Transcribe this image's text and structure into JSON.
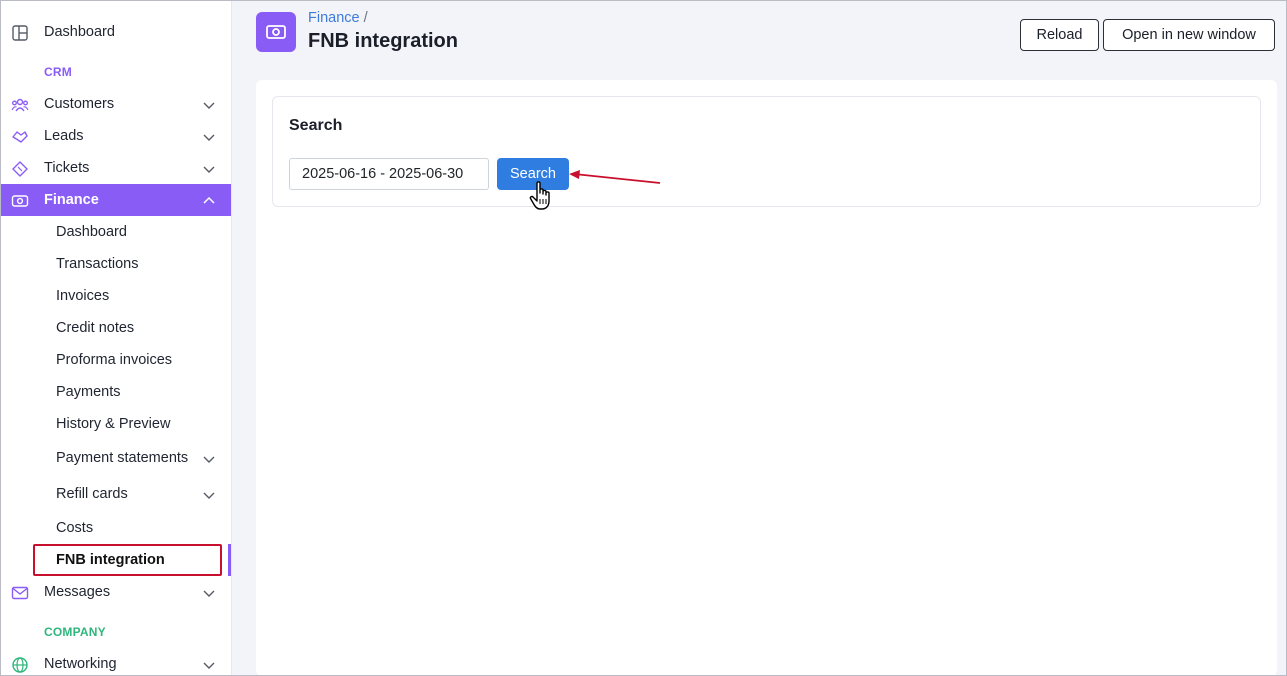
{
  "sidebar": {
    "dashboard": "Dashboard",
    "crm_section": "CRM",
    "crm_items": [
      {
        "label": "Customers",
        "icon": "customers-icon"
      },
      {
        "label": "Leads",
        "icon": "leads-icon"
      },
      {
        "label": "Tickets",
        "icon": "tickets-icon"
      }
    ],
    "finance": {
      "label": "Finance",
      "icon": "finance-icon"
    },
    "finance_sub": [
      "Dashboard",
      "Transactions",
      "Invoices",
      "Credit notes",
      "Proforma invoices",
      "Payments",
      "History & Preview",
      "Payment statements",
      "Refill cards",
      "Costs",
      "FNB integration"
    ],
    "messages": "Messages",
    "company_section": "COMPANY",
    "networking": "Networking"
  },
  "header": {
    "breadcrumb": "Finance",
    "breadcrumb_sep": "/",
    "title": "FNB integration",
    "reload_label": "Reload",
    "open_window_label": "Open in new window"
  },
  "search": {
    "title": "Search",
    "date_range_value": "2025-06-16 - 2025-06-30",
    "button_label": "Search"
  },
  "colors": {
    "accent": "#8a5cf6",
    "primary_button": "#2f7de1",
    "crm_label": "#8a5cf6",
    "company_label": "#2fb67c",
    "annotation": "#c8102e"
  }
}
